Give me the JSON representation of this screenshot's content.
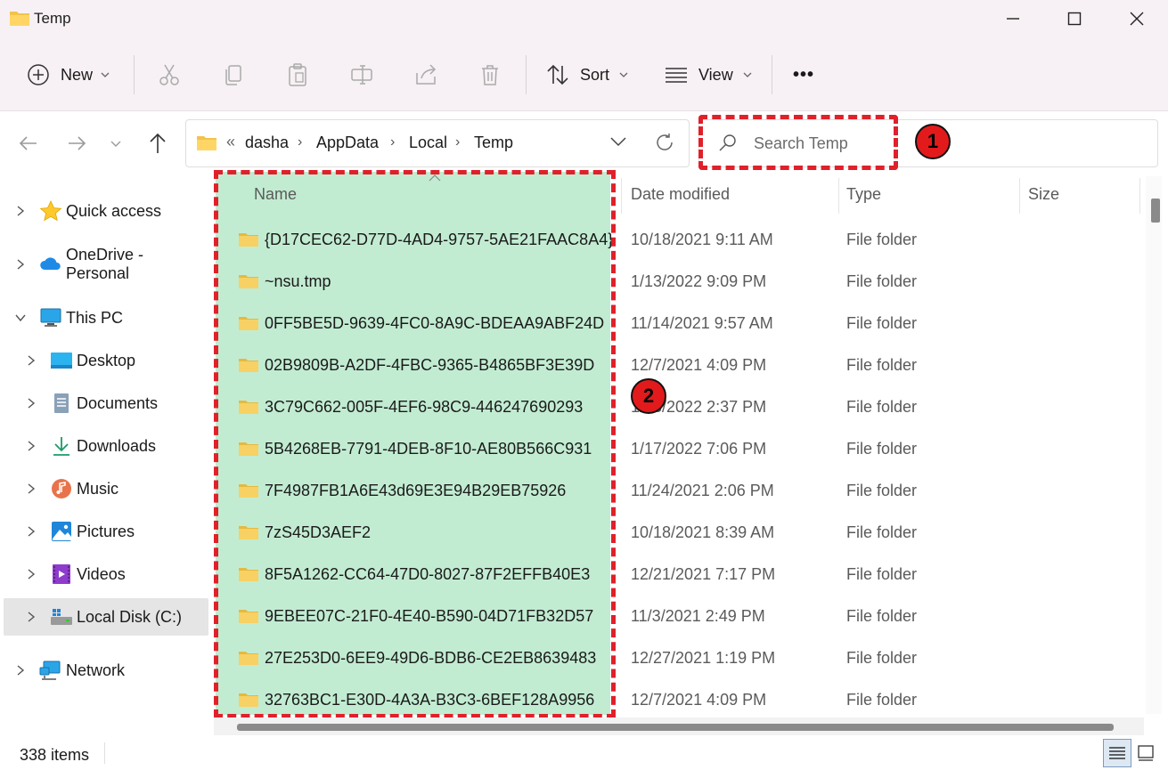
{
  "window": {
    "title": "Temp"
  },
  "toolbar": {
    "new_label": "New",
    "sort_label": "Sort",
    "view_label": "View",
    "more_label": "•••"
  },
  "nav": {
    "breadcrumb_overflow": "«",
    "breadcrumbs": [
      "dasha",
      "AppData",
      "Local",
      "Temp"
    ],
    "search_placeholder": "Search Temp"
  },
  "sidebar": {
    "items": [
      {
        "label": "Quick access",
        "icon": "star-icon"
      },
      {
        "label": "OneDrive - Personal",
        "icon": "cloud-icon"
      },
      {
        "label": "This PC",
        "icon": "monitor-icon"
      },
      {
        "label": "Desktop",
        "icon": "desktop-icon"
      },
      {
        "label": "Documents",
        "icon": "documents-icon"
      },
      {
        "label": "Downloads",
        "icon": "download-icon"
      },
      {
        "label": "Music",
        "icon": "music-icon"
      },
      {
        "label": "Pictures",
        "icon": "pictures-icon"
      },
      {
        "label": "Videos",
        "icon": "videos-icon"
      },
      {
        "label": "Local Disk (C:)",
        "icon": "drive-icon"
      },
      {
        "label": "Network",
        "icon": "network-icon"
      }
    ]
  },
  "columns": {
    "name": "Name",
    "date": "Date modified",
    "type": "Type",
    "size": "Size"
  },
  "files": [
    {
      "name": "{D17CEC62-D77D-4AD4-9757-5AE21FAAC8A4}",
      "date": "10/18/2021 9:11 AM",
      "type": "File folder"
    },
    {
      "name": "~nsu.tmp",
      "date": "1/13/2022 9:09 PM",
      "type": "File folder"
    },
    {
      "name": "0FF5BE5D-9639-4FC0-8A9C-BDEAA9ABF24D",
      "date": "11/14/2021 9:57 AM",
      "type": "File folder"
    },
    {
      "name": "02B9809B-A2DF-4FBC-9365-B4865BF3E39D",
      "date": "12/7/2021 4:09 PM",
      "type": "File folder"
    },
    {
      "name": "3C79C662-005F-4EF6-98C9-446247690293",
      "date": "1/13/2022 2:37 PM",
      "type": "File folder"
    },
    {
      "name": "5B4268EB-7791-4DEB-8F10-AE80B566C931",
      "date": "1/17/2022 7:06 PM",
      "type": "File folder"
    },
    {
      "name": "7F4987FB1A6E43d69E3E94B29EB75926",
      "date": "11/24/2021 2:06 PM",
      "type": "File folder"
    },
    {
      "name": "7zS45D3AEF2",
      "date": "10/18/2021 8:39 AM",
      "type": "File folder"
    },
    {
      "name": "8F5A1262-CC64-47D0-8027-87F2EFFB40E3",
      "date": "12/21/2021 7:17 PM",
      "type": "File folder"
    },
    {
      "name": "9EBEE07C-21F0-4E40-B590-04D71FB32D57",
      "date": "11/3/2021 2:49 PM",
      "type": "File folder"
    },
    {
      "name": "27E253D0-6EE9-49D6-BDB6-CE2EB8639483",
      "date": "12/27/2021 1:19 PM",
      "type": "File folder"
    },
    {
      "name": "32763BC1-E30D-4A3A-B3C3-6BEF128A9956",
      "date": "12/7/2021 4:09 PM",
      "type": "File folder"
    }
  ],
  "annotations": {
    "badge_1": "1",
    "badge_2": "2"
  },
  "status": {
    "item_count": "338 items"
  },
  "colors": {
    "highlight_fill": "#c2ecd2",
    "annotation_red": "#e0202a",
    "chrome_bg": "#f7f0f4"
  }
}
